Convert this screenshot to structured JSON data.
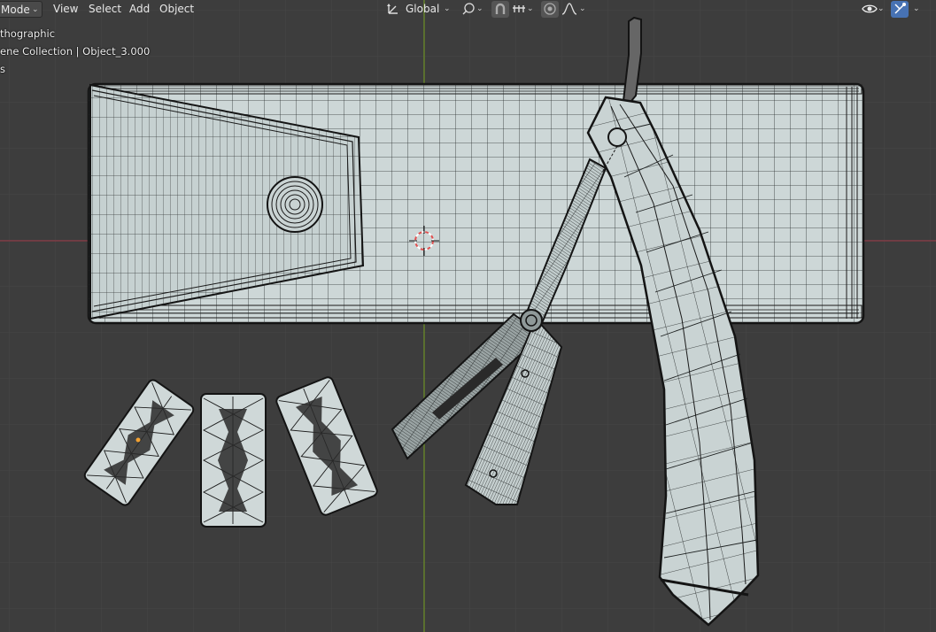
{
  "header": {
    "mode_label": "Mode",
    "menus": [
      "View",
      "Select",
      "Add",
      "Object"
    ],
    "transform_orientation": "Global"
  },
  "overlay": {
    "view_name": "thographic",
    "collection_path": "ene Collection | Object_3.000",
    "units_label": "s"
  },
  "icons": {
    "orientation": "transform-orientation-icon",
    "pivot": "pivot-point-icon",
    "snap": "snap-magnet-icon",
    "snap_target": "snap-increment-icon",
    "proportional": "proportional-editing-icon",
    "falloff": "falloff-curve-icon",
    "visibility": "eye-visibility-icon",
    "gizmo": "gizmo-toggle-icon"
  },
  "colors": {
    "viewport_bg": "#3d3d3d",
    "grid_line": "#474747",
    "x_axis": "#8a3a44",
    "y_axis": "#6b8e23",
    "mesh_fill": "#c9d3d3",
    "wire": "#1a1a1a",
    "active_button": "#4772b3"
  }
}
